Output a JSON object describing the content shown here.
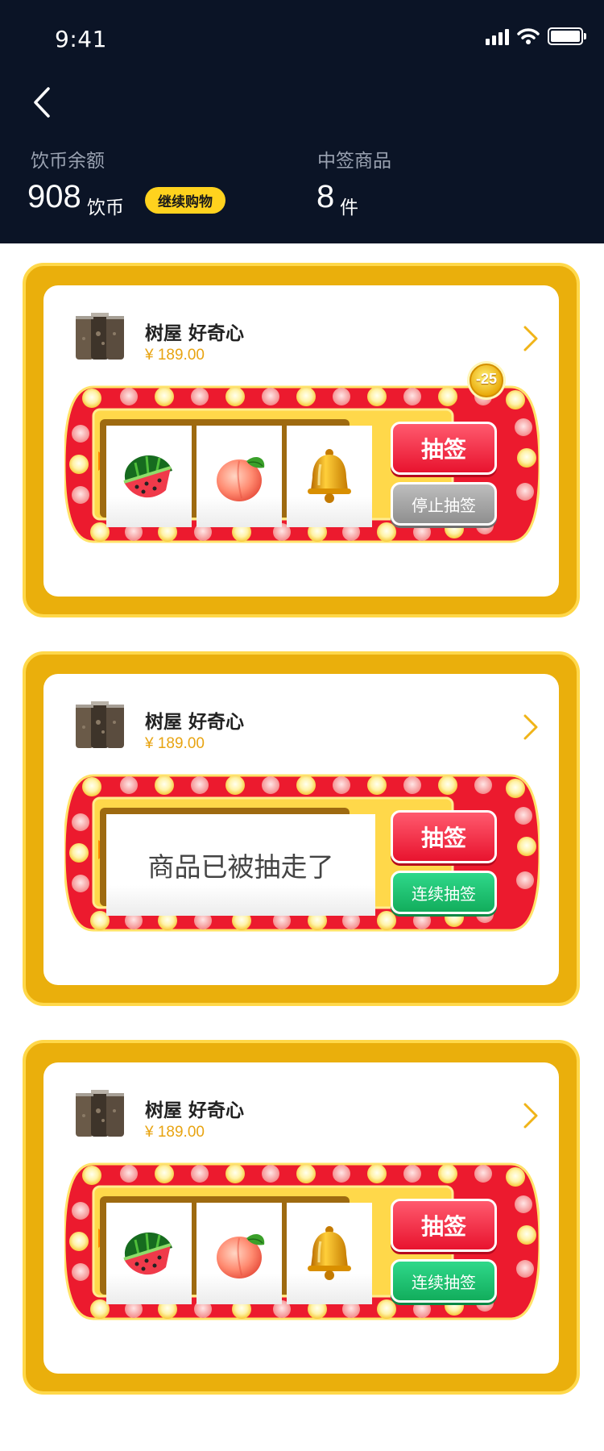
{
  "status_bar": {
    "time": "9:41"
  },
  "header": {
    "balance_label": "饮币余额",
    "balance_value": "908",
    "balance_unit": "饮币",
    "continue_label": "继续购物",
    "won_label": "中签商品",
    "won_value": "8",
    "won_unit": "件"
  },
  "cards": [
    {
      "name": "树屋  好奇心",
      "price": "¥ 189.00",
      "reels": [
        "watermelon-icon",
        "peach-icon",
        "bell-icon"
      ],
      "badge": "-25",
      "draw_label": "抽签",
      "action_label": "停止抽签"
    },
    {
      "name": "树屋  好奇心",
      "price": "¥ 189.00",
      "message": "商品已被抽走了",
      "draw_label": "抽签",
      "action_label": "连续抽签"
    },
    {
      "name": "树屋  好奇心",
      "price": "¥ 189.00",
      "reels": [
        "watermelon-icon",
        "peach-icon",
        "bell-icon"
      ],
      "draw_label": "抽签",
      "action_label": "连续抽签"
    }
  ],
  "colors": {
    "header_bg": "#0b1426",
    "accent_yellow": "#ffd21e",
    "frame_gold": "#eaaf0c",
    "machine_red": "#e8132e",
    "price_orange": "#e8a412",
    "continue_green": "#12ad5c",
    "stop_gray": "#8f8f8f"
  }
}
